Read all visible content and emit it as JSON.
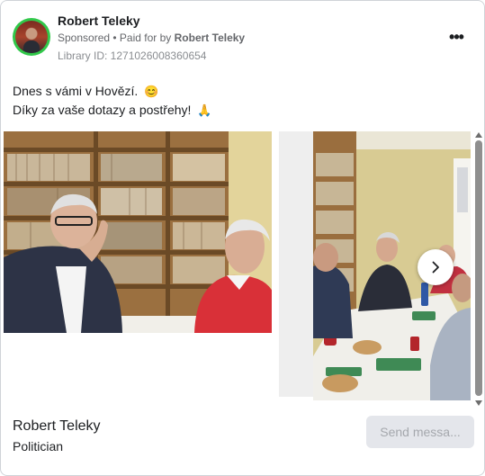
{
  "ad": {
    "advertiser_name": "Robert Teleky",
    "sponsored_label": "Sponsored",
    "separator": " • ",
    "paid_for_prefix": "Paid for by ",
    "paid_for_name": "Robert Teleky",
    "library_id": "Library ID: 1271026008360654",
    "more_icon": "more-horizontal-icon",
    "more_label": "•••"
  },
  "post": {
    "line1": "Dnes s vámi v Hovězí.",
    "line1_emoji": "😊",
    "line2": "Díky za vaše dotazy a postřehy!",
    "line2_emoji": "🙏"
  },
  "carousel": {
    "next_icon": "chevron-right-icon"
  },
  "footer": {
    "page_name": "Robert Teleky",
    "category": "Politician",
    "cta_label": "Send messa..."
  },
  "colors": {
    "avatar_ring": "#31c84a",
    "cta_bg": "#e4e6eb",
    "cta_text": "#a5a8ad",
    "muted_text": "#65676b"
  }
}
